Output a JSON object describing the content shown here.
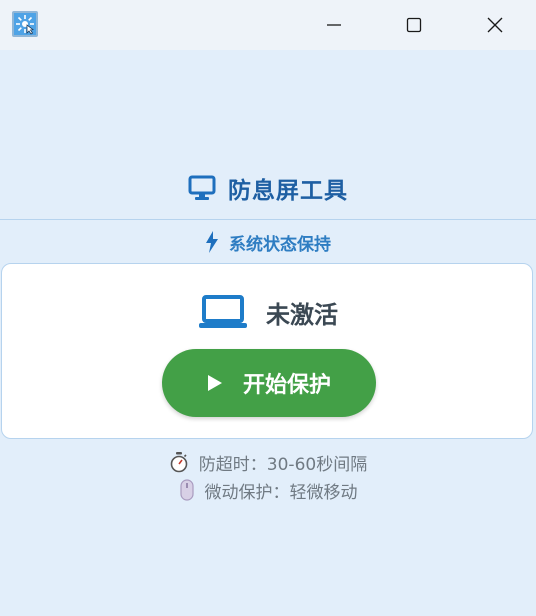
{
  "window": {
    "controls": {
      "minimize_icon": "minimize-icon",
      "maximize_icon": "maximize-icon",
      "close_icon": "close-icon"
    }
  },
  "header": {
    "title": "防息屏工具",
    "icon": "monitor-icon"
  },
  "subtitle": {
    "text": "系统状态保持",
    "icon": "lightning-icon"
  },
  "status": {
    "text": "未激活",
    "icon": "laptop-icon"
  },
  "start_button": {
    "label": "开始保护",
    "icon": "play-icon"
  },
  "info": [
    {
      "icon": "stopwatch-icon",
      "text": "防超时：30-60秒间隔"
    },
    {
      "icon": "mouse-icon",
      "text": "微动保护：轻微移动"
    }
  ],
  "colors": {
    "background": "#e2eefa",
    "title": "#1e5fa3",
    "accent": "#2e7dc2",
    "button": "#43a047",
    "status_text": "#3b4853",
    "info_text": "#707a83"
  }
}
